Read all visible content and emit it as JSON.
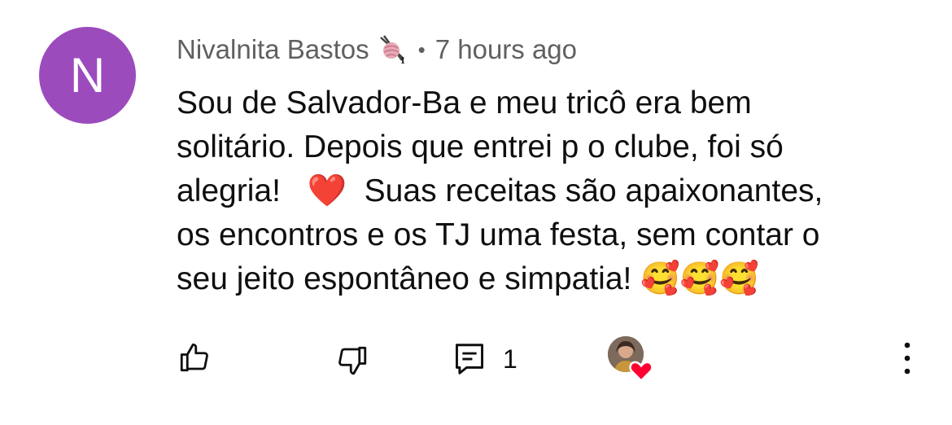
{
  "comment": {
    "avatar_letter": "N",
    "avatar_color": "#9c4bbd",
    "author": "Nivalnita Bastos",
    "badge_icon": "yarn-ball-knitting-icon",
    "badge_level": "1",
    "separator": "•",
    "timestamp": "7 hours ago",
    "text_line1": "Sou de Salvador-Ba e meu tricô era bem",
    "text_line2": "solitário. Depois que entrei p o clube, foi só",
    "text_line3_a": "alegria!",
    "text_line3_emoji": "❤️",
    "text_line3_b": "Suas receitas são apaixonantes,",
    "text_line4": "os encontros e os TJ uma festa, sem contar o",
    "text_line5": "seu jeito espontâneo e simpatia!",
    "text_line5_emoji": "🥰🥰🥰"
  },
  "actions": {
    "like_icon": "thumb-up-icon",
    "dislike_icon": "thumb-down-icon",
    "reply_icon": "comment-reply-icon",
    "reply_count": "1",
    "creator_heart_icon": "creator-heart-icon",
    "more_icon": "more-vertical-icon"
  }
}
